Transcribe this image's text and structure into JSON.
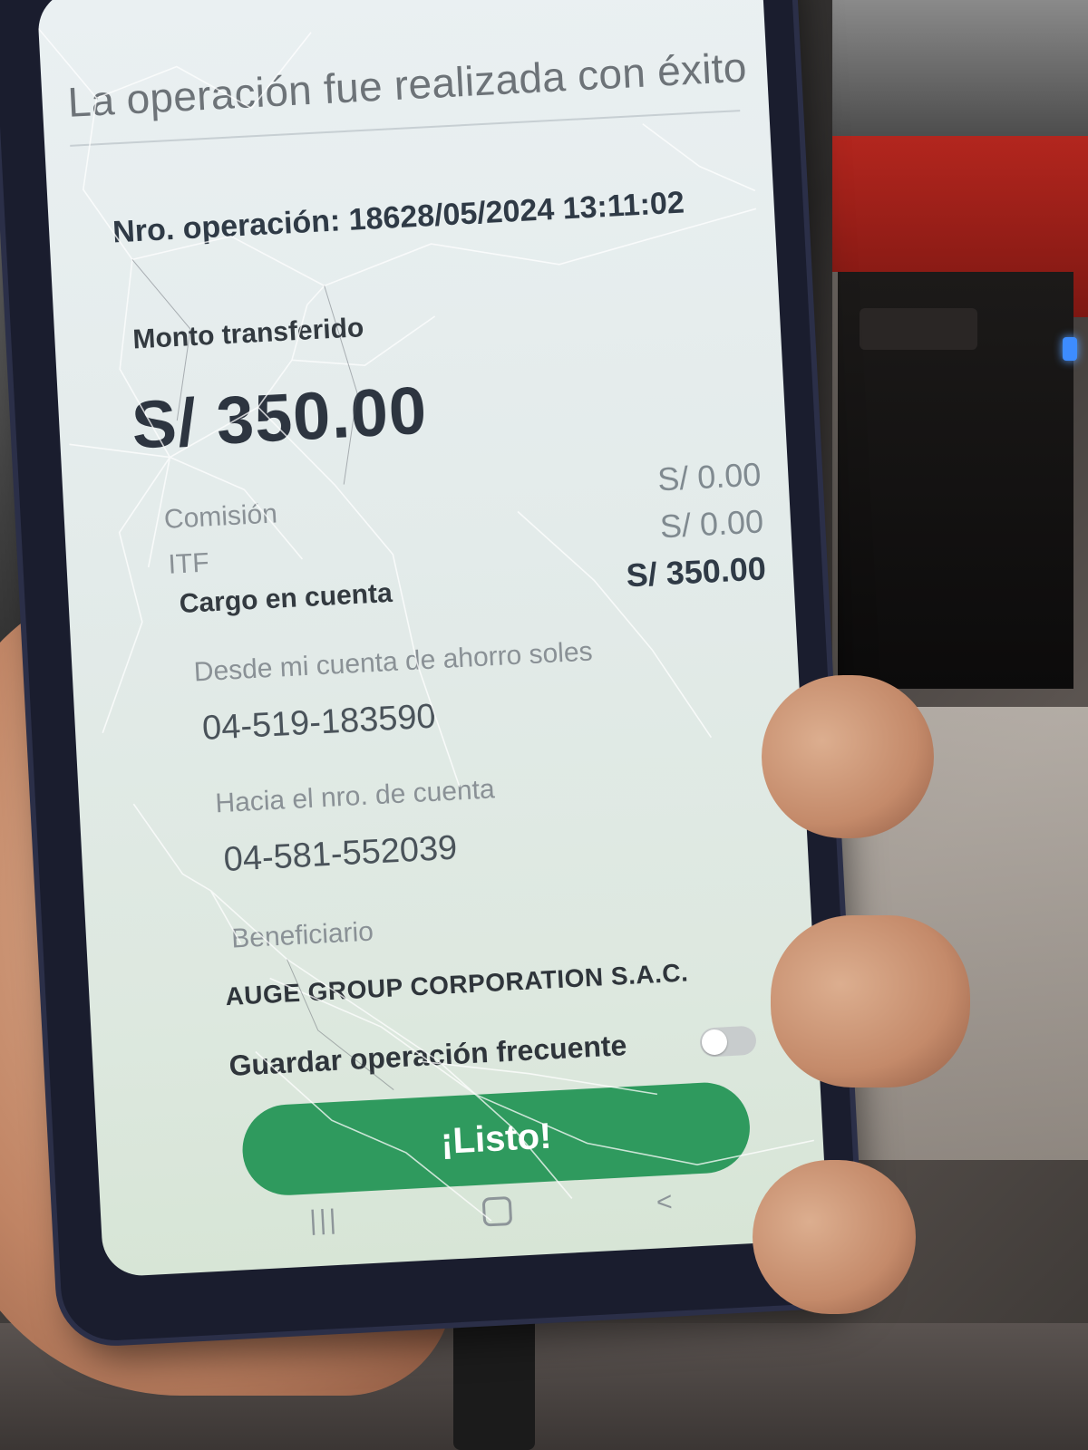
{
  "transaction": {
    "success_message": "La operación fue realizada con éxito",
    "operation_line": "Nro. operación: 18628/05/2024 13:11:02",
    "transferred_label": "Monto transferido",
    "transferred_amount": "S/ 350.00",
    "commission_label": "Comisión",
    "commission_value": "S/ 0.00",
    "itf_label": "ITF",
    "itf_value": "S/ 0.00",
    "debit_label": "Cargo en cuenta",
    "debit_value": "S/ 350.00",
    "from_label": "Desde mi cuenta de ahorro soles",
    "from_account": "04-519-183590",
    "to_label": "Hacia el nro. de cuenta",
    "to_account": "04-581-552039",
    "beneficiary_label": "Beneficiario",
    "beneficiary_name": "AUGE GROUP CORPORATION S.A.C."
  },
  "actions": {
    "save_frequent_label": "Guardar operación frecuente",
    "save_frequent_enabled": false,
    "done_button_label": "¡Listo!",
    "button_color": "#2f9a5e"
  },
  "navigation": {
    "recent_icon": "|||",
    "back_icon": "<"
  }
}
